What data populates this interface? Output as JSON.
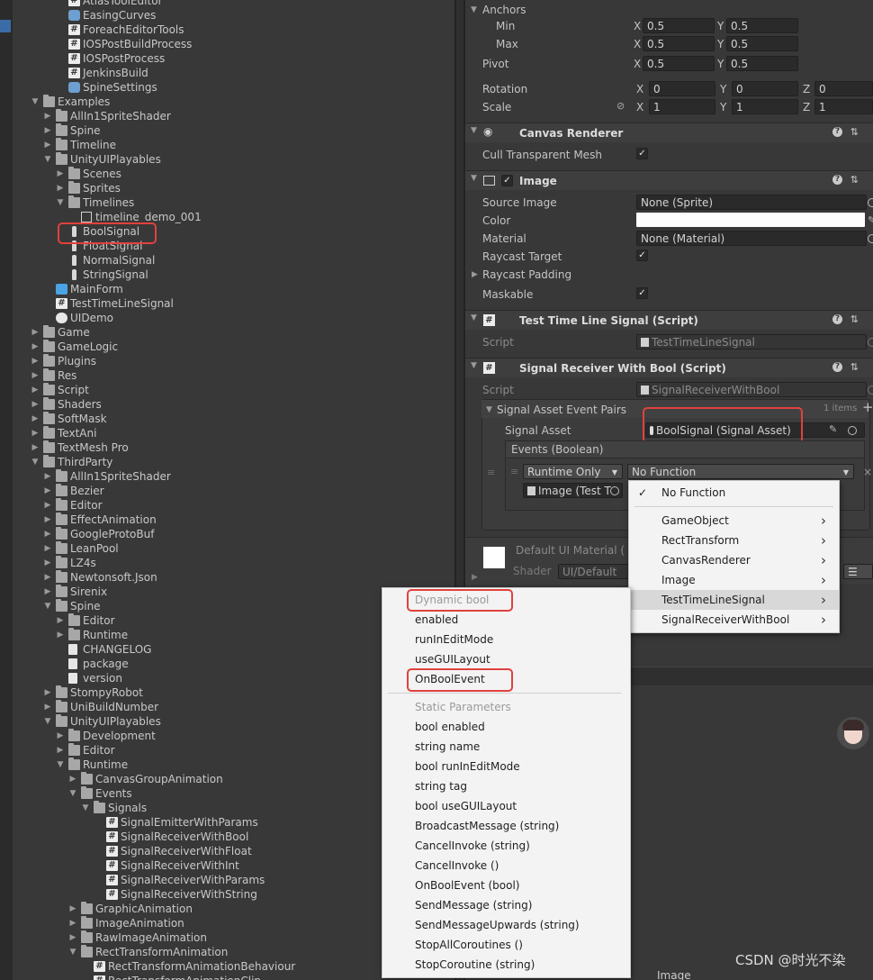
{
  "project_tree": [
    {
      "label": "AtlasToolEditor",
      "icon": "cs-script-icon",
      "depth": 3,
      "arrow": ""
    },
    {
      "label": "EasingCurves",
      "icon": "asset-icon",
      "depth": 3,
      "arrow": ""
    },
    {
      "label": "ForeachEditorTools",
      "icon": "cs-script-icon",
      "depth": 3,
      "arrow": ""
    },
    {
      "label": "IOSPostBuildProcess",
      "icon": "cs-script-icon",
      "depth": 3,
      "arrow": ""
    },
    {
      "label": "IOSPostProcess",
      "icon": "cs-script-icon",
      "depth": 3,
      "arrow": ""
    },
    {
      "label": "JenkinsBuild",
      "icon": "cs-script-icon",
      "depth": 3,
      "arrow": ""
    },
    {
      "label": "SpineSettings",
      "icon": "asset-icon",
      "depth": 3,
      "arrow": ""
    },
    {
      "label": "Examples",
      "icon": "folder-icon",
      "depth": 1,
      "arrow": "open"
    },
    {
      "label": "AllIn1SpriteShader",
      "icon": "folder-icon",
      "depth": 2,
      "arrow": "closed"
    },
    {
      "label": "Spine",
      "icon": "folder-icon",
      "depth": 2,
      "arrow": "closed"
    },
    {
      "label": "Timeline",
      "icon": "folder-icon",
      "depth": 2,
      "arrow": "closed"
    },
    {
      "label": "UnityUIPlayables",
      "icon": "folder-icon",
      "depth": 2,
      "arrow": "open"
    },
    {
      "label": "Scenes",
      "icon": "folder-icon",
      "depth": 3,
      "arrow": "closed"
    },
    {
      "label": "Sprites",
      "icon": "folder-icon",
      "depth": 3,
      "arrow": "closed"
    },
    {
      "label": "Timelines",
      "icon": "folder-icon",
      "depth": 3,
      "arrow": "open"
    },
    {
      "label": "timeline_demo_001",
      "icon": "timeline-icon",
      "depth": 4,
      "arrow": ""
    },
    {
      "label": "BoolSignal",
      "icon": "signal-icon",
      "depth": 3,
      "arrow": ""
    },
    {
      "label": "FloatSignal",
      "icon": "signal-icon",
      "depth": 3,
      "arrow": ""
    },
    {
      "label": "NormalSignal",
      "icon": "signal-icon",
      "depth": 3,
      "arrow": ""
    },
    {
      "label": "StringSignal",
      "icon": "signal-icon",
      "depth": 3,
      "arrow": ""
    },
    {
      "label": "MainForm",
      "icon": "prefab-icon",
      "depth": 2,
      "arrow": ""
    },
    {
      "label": "TestTimeLineSignal",
      "icon": "cs-script-icon",
      "depth": 2,
      "arrow": ""
    },
    {
      "label": "UIDemo",
      "icon": "unity-scene-icon",
      "depth": 2,
      "arrow": ""
    },
    {
      "label": "Game",
      "icon": "folder-icon",
      "depth": 1,
      "arrow": "closed"
    },
    {
      "label": "GameLogic",
      "icon": "folder-icon",
      "depth": 1,
      "arrow": "closed"
    },
    {
      "label": "Plugins",
      "icon": "folder-icon",
      "depth": 1,
      "arrow": "closed"
    },
    {
      "label": "Res",
      "icon": "folder-icon",
      "depth": 1,
      "arrow": "closed"
    },
    {
      "label": "Script",
      "icon": "folder-icon",
      "depth": 1,
      "arrow": "closed"
    },
    {
      "label": "Shaders",
      "icon": "folder-icon",
      "depth": 1,
      "arrow": "closed"
    },
    {
      "label": "SoftMask",
      "icon": "folder-icon",
      "depth": 1,
      "arrow": "closed"
    },
    {
      "label": "TextAni",
      "icon": "folder-icon",
      "depth": 1,
      "arrow": "closed"
    },
    {
      "label": "TextMesh Pro",
      "icon": "folder-icon",
      "depth": 1,
      "arrow": "closed"
    },
    {
      "label": "ThirdParty",
      "icon": "folder-icon",
      "depth": 1,
      "arrow": "open"
    },
    {
      "label": "AllIn1SpriteShader",
      "icon": "folder-icon",
      "depth": 2,
      "arrow": "closed"
    },
    {
      "label": "Bezier",
      "icon": "folder-icon",
      "depth": 2,
      "arrow": "closed"
    },
    {
      "label": "Editor",
      "icon": "folder-icon",
      "depth": 2,
      "arrow": "closed"
    },
    {
      "label": "EffectAnimation",
      "icon": "folder-icon",
      "depth": 2,
      "arrow": "closed"
    },
    {
      "label": "GoogleProtoBuf",
      "icon": "folder-icon",
      "depth": 2,
      "arrow": "closed"
    },
    {
      "label": "LeanPool",
      "icon": "folder-icon",
      "depth": 2,
      "arrow": "closed"
    },
    {
      "label": "LZ4s",
      "icon": "folder-icon",
      "depth": 2,
      "arrow": "closed"
    },
    {
      "label": "Newtonsoft.Json",
      "icon": "folder-icon",
      "depth": 2,
      "arrow": "closed"
    },
    {
      "label": "Sirenix",
      "icon": "folder-icon",
      "depth": 2,
      "arrow": "closed"
    },
    {
      "label": "Spine",
      "icon": "folder-icon",
      "depth": 2,
      "arrow": "open"
    },
    {
      "label": "Editor",
      "icon": "folder-icon",
      "depth": 3,
      "arrow": "closed"
    },
    {
      "label": "Runtime",
      "icon": "folder-icon",
      "depth": 3,
      "arrow": "closed"
    },
    {
      "label": "CHANGELOG",
      "icon": "text-file-icon",
      "depth": 3,
      "arrow": ""
    },
    {
      "label": "package",
      "icon": "text-file-icon",
      "depth": 3,
      "arrow": ""
    },
    {
      "label": "version",
      "icon": "text-file-icon",
      "depth": 3,
      "arrow": ""
    },
    {
      "label": "StompyRobot",
      "icon": "folder-icon",
      "depth": 2,
      "arrow": "closed"
    },
    {
      "label": "UniBuildNumber",
      "icon": "folder-icon",
      "depth": 2,
      "arrow": "closed"
    },
    {
      "label": "UnityUIPlayables",
      "icon": "folder-icon",
      "depth": 2,
      "arrow": "open"
    },
    {
      "label": "Development",
      "icon": "folder-icon",
      "depth": 3,
      "arrow": "closed"
    },
    {
      "label": "Editor",
      "icon": "folder-icon",
      "depth": 3,
      "arrow": "closed"
    },
    {
      "label": "Runtime",
      "icon": "folder-icon",
      "depth": 3,
      "arrow": "open"
    },
    {
      "label": "CanvasGroupAnimation",
      "icon": "folder-icon",
      "depth": 4,
      "arrow": "closed"
    },
    {
      "label": "Events",
      "icon": "folder-icon",
      "depth": 4,
      "arrow": "open"
    },
    {
      "label": "Signals",
      "icon": "folder-icon",
      "depth": 5,
      "arrow": "open"
    },
    {
      "label": "SignalEmitterWithParams",
      "icon": "cs-script-icon",
      "depth": 6,
      "arrow": ""
    },
    {
      "label": "SignalReceiverWithBool",
      "icon": "cs-script-icon",
      "depth": 6,
      "arrow": ""
    },
    {
      "label": "SignalReceiverWithFloat",
      "icon": "cs-script-icon",
      "depth": 6,
      "arrow": ""
    },
    {
      "label": "SignalReceiverWithInt",
      "icon": "cs-script-icon",
      "depth": 6,
      "arrow": ""
    },
    {
      "label": "SignalReceiverWithParams",
      "icon": "cs-script-icon",
      "depth": 6,
      "arrow": ""
    },
    {
      "label": "SignalReceiverWithString",
      "icon": "cs-script-icon",
      "depth": 6,
      "arrow": ""
    },
    {
      "label": "GraphicAnimation",
      "icon": "folder-icon",
      "depth": 4,
      "arrow": "closed"
    },
    {
      "label": "ImageAnimation",
      "icon": "folder-icon",
      "depth": 4,
      "arrow": "closed"
    },
    {
      "label": "RawImageAnimation",
      "icon": "folder-icon",
      "depth": 4,
      "arrow": "closed"
    },
    {
      "label": "RectTransformAnimation",
      "icon": "folder-icon",
      "depth": 4,
      "arrow": "open"
    },
    {
      "label": "RectTransformAnimationBehaviour",
      "icon": "cs-script-icon",
      "depth": 5,
      "arrow": ""
    },
    {
      "label": "RectTransformAnimationClip",
      "icon": "cs-script-icon",
      "depth": 5,
      "arrow": ""
    }
  ],
  "inspector": {
    "anchors": {
      "label": "Anchors",
      "min_label": "Min",
      "max_label": "Max",
      "min_x": "0.5",
      "min_y": "0.5",
      "max_x": "0.5",
      "max_y": "0.5"
    },
    "pivot": {
      "label": "Pivot",
      "x": "0.5",
      "y": "0.5"
    },
    "rotation": {
      "label": "Rotation",
      "x": "0",
      "y": "0",
      "z": "0"
    },
    "scale": {
      "label": "Scale",
      "x": "1",
      "y": "1",
      "z": "1"
    },
    "axis_x": "X",
    "axis_y": "Y",
    "axis_z": "Z",
    "canvas_renderer": {
      "title": "Canvas Renderer",
      "cull_label": "Cull Transparent Mesh",
      "cull_checked": true
    },
    "image": {
      "title": "Image",
      "source_image_label": "Source Image",
      "source_image_value": "None (Sprite)",
      "color_label": "Color",
      "color_value": "#ffffff",
      "material_label": "Material",
      "material_value": "None (Material)",
      "raycast_target_label": "Raycast Target",
      "raycast_padding_label": "Raycast Padding",
      "maskable_label": "Maskable"
    },
    "test_signal": {
      "title": "Test Time Line Signal (Script)",
      "script_label": "Script",
      "script_value": "TestTimeLineSignal"
    },
    "signal_receiver": {
      "title": "Signal Receiver With Bool (Script)",
      "script_label": "Script",
      "script_value": "SignalReceiverWithBool",
      "pairs_label": "Signal Asset Event Pairs",
      "items_count": "1 items",
      "signal_asset_label": "Signal Asset",
      "signal_asset_value": "BoolSignal (Signal Asset)",
      "events_label": "Events (Boolean)",
      "runtime_mode": "Runtime Only",
      "function_value": "No Function",
      "target_value": "Image (Test T"
    },
    "material": {
      "name": "Default UI Material (",
      "shader_label": "Shader",
      "shader_value": "UI/Default"
    },
    "bottom_label": "Image"
  },
  "function_menu": {
    "items": [
      {
        "label": "No Function",
        "checked": true,
        "submenu": false
      },
      {
        "label": "GameObject",
        "checked": false,
        "submenu": true
      },
      {
        "label": "RectTransform",
        "checked": false,
        "submenu": true
      },
      {
        "label": "CanvasRenderer",
        "checked": false,
        "submenu": true
      },
      {
        "label": "Image",
        "checked": false,
        "submenu": true
      },
      {
        "label": "TestTimeLineSignal",
        "checked": false,
        "submenu": true,
        "hovered": true
      },
      {
        "label": "SignalReceiverWithBool",
        "checked": false,
        "submenu": true
      }
    ]
  },
  "submenu": {
    "dynamic_header": "Dynamic bool",
    "dynamic_items": [
      "enabled",
      "runInEditMode",
      "useGUILayout",
      "OnBoolEvent"
    ],
    "static_header": "Static Parameters",
    "static_items": [
      "bool enabled",
      "string name",
      "bool runInEditMode",
      "string tag",
      "bool useGUILayout",
      "BroadcastMessage (string)",
      "CancelInvoke (string)",
      "CancelInvoke ()",
      "OnBoolEvent (bool)",
      "SendMessage (string)",
      "SendMessageUpwards (string)",
      "StopAllCoroutines ()",
      "StopCoroutine (string)"
    ]
  },
  "watermark": "CSDN @时光不染",
  "colors": {
    "highlight_box": "#e0413e",
    "panel_bg": "#383838",
    "menu_bg": "#f3f3f3"
  }
}
